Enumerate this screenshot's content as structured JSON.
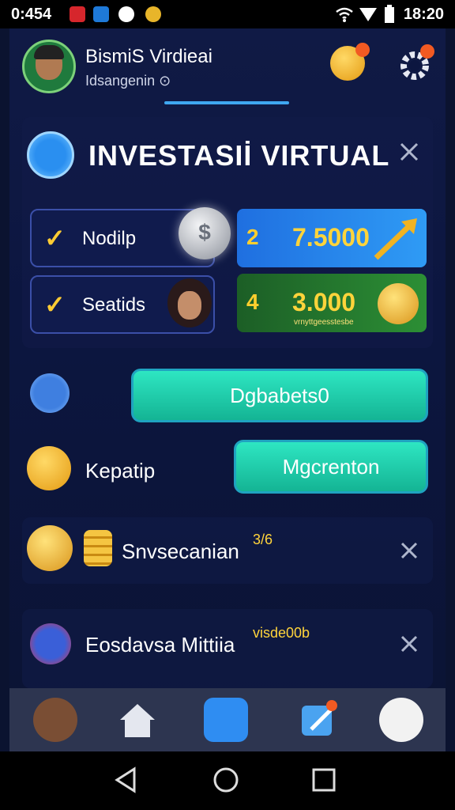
{
  "status_bar": {
    "time": "0:454",
    "clock": "18:20"
  },
  "header": {
    "title": "BismiS Virdieai",
    "subtitle": "Idsangenin ⊙"
  },
  "invest": {
    "title": "INVESTASIİ VIRTUAL"
  },
  "options": [
    {
      "label": "Nodilp"
    },
    {
      "label": "Seatids"
    }
  ],
  "panels": [
    {
      "prefix": "2",
      "value": "7.5000"
    },
    {
      "prefix": "4",
      "value": "3.000",
      "note": "vrnyttgeesstesbe"
    }
  ],
  "actions": {
    "primary_label": "Dgbabets0",
    "row_label": "Kepatip",
    "secondary_label": "Mgcrenton"
  },
  "list": [
    {
      "label": "Snvsecanian",
      "meta": "3/6"
    },
    {
      "label": "Eosdavsa Mittiia",
      "meta": "visde00b"
    }
  ],
  "colors": {
    "accent": "#2ee6c2",
    "gold": "#ffd43b",
    "badge": "#f25a22"
  }
}
